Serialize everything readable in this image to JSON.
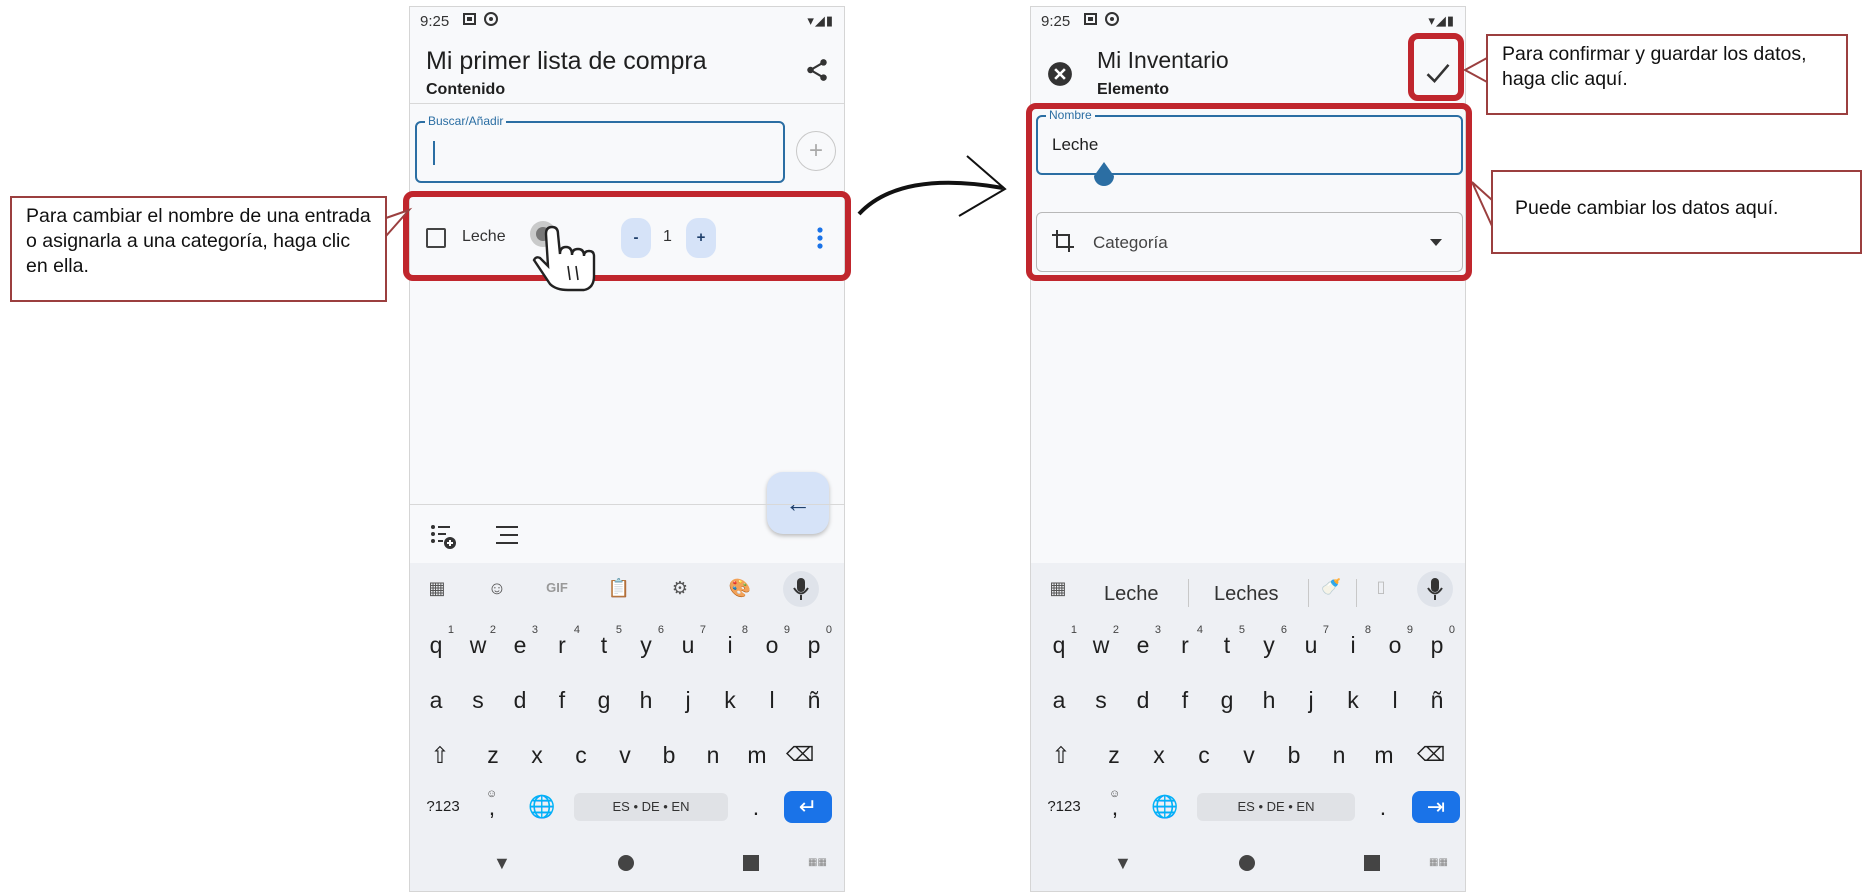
{
  "left_phone": {
    "status": {
      "time": "9:25"
    },
    "header": {
      "title": "Mi primer lista de compra",
      "subtitle": "Contenido"
    },
    "search": {
      "legend": "Buscar/Añadir",
      "value": ""
    },
    "list_item": {
      "name": "Leche",
      "quantity": "1",
      "minus": "-",
      "plus": "+"
    },
    "keyboard": {
      "toolbar": [
        "apps-icon",
        "sticker-icon",
        "GIF",
        "clipboard-icon",
        "settings-icon",
        "palette-icon",
        "mic-icon"
      ],
      "gif_label": "GIF",
      "row1": [
        "q",
        "w",
        "e",
        "r",
        "t",
        "y",
        "u",
        "i",
        "o",
        "p"
      ],
      "row1_digits": [
        "1",
        "2",
        "3",
        "4",
        "5",
        "6",
        "7",
        "8",
        "9",
        "0"
      ],
      "row2": [
        "a",
        "s",
        "d",
        "f",
        "g",
        "h",
        "j",
        "k",
        "l",
        "ñ"
      ],
      "row3": [
        "z",
        "x",
        "c",
        "v",
        "b",
        "n",
        "m"
      ],
      "symbols_key": "?123",
      "comma_key": ",",
      "space_label": "ES • DE • EN",
      "period_key": "."
    }
  },
  "right_phone": {
    "status": {
      "time": "9:25"
    },
    "header": {
      "title": "Mi Inventario",
      "subtitle": "Elemento"
    },
    "name_field": {
      "legend": "Nombre",
      "value": "Leche"
    },
    "category": {
      "label": "Categoría"
    },
    "keyboard": {
      "suggestions": [
        "Leche",
        "Leches"
      ],
      "row1": [
        "q",
        "w",
        "e",
        "r",
        "t",
        "y",
        "u",
        "i",
        "o",
        "p"
      ],
      "row1_digits": [
        "1",
        "2",
        "3",
        "4",
        "5",
        "6",
        "7",
        "8",
        "9",
        "0"
      ],
      "row2": [
        "a",
        "s",
        "d",
        "f",
        "g",
        "h",
        "j",
        "k",
        "l",
        "ñ"
      ],
      "row3": [
        "z",
        "x",
        "c",
        "v",
        "b",
        "n",
        "m"
      ],
      "symbols_key": "?123",
      "comma_key": ",",
      "space_label": "ES • DE • EN",
      "period_key": "."
    }
  },
  "annotations": {
    "left_callout": "Para cambiar el nombre de una entrada o asignarla a una categoría, haga clic en ella.",
    "top_right_callout": "Para confirmar y guardar los datos, haga clic aquí.",
    "middle_right_callout": "Puede cambiar los datos aquí."
  },
  "colors": {
    "highlight_red": "#c0262d",
    "accent_blue": "#1a73e8",
    "field_blue": "#2b6ea3"
  }
}
